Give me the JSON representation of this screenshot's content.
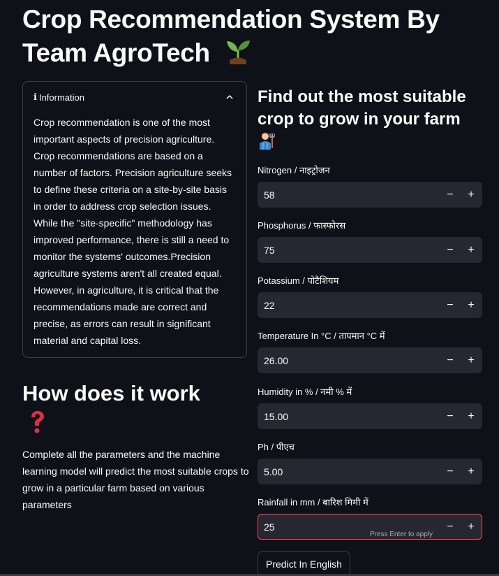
{
  "page": {
    "title": "Crop Recommendation System By Team AgroTech",
    "title_emoji": "seedling"
  },
  "info_panel": {
    "header_icon": "ℹ",
    "header_label": "Information",
    "expanded": true,
    "body": "Crop recommendation is one of the most important aspects of precision agriculture. Crop recommendations are based on a number of factors. Precision agriculture seeks to define these criteria on a site-by-site basis in order to address crop selection issues. While the \"site-specific\" methodology has improved performance, there is still a need to monitor the systems' outcomes.Precision agriculture systems aren't all created equal. However, in agriculture, it is critical that the recommendations made are correct and precise, as errors can result in significant material and capital loss."
  },
  "how": {
    "title": "How does it work",
    "title_emoji": "question-mark",
    "text": "Complete all the parameters and the machine learning model will predict the most suitable crops to grow in a particular farm based on various parameters"
  },
  "form": {
    "title": "Find out the most suitable crop to grow in your farm",
    "title_emoji": "farmer",
    "fields": [
      {
        "label": "Nitrogen / नाइट्रोजन",
        "value": "58"
      },
      {
        "label": "Phosphorus / फास्फोरस",
        "value": "75"
      },
      {
        "label": "Potassium / पोटैशियम",
        "value": "22"
      },
      {
        "label": "Temperature In °C / तापमान °C में",
        "value": "26.00"
      },
      {
        "label": "Humidity in % / नमी % में",
        "value": "15.00"
      },
      {
        "label": "Ph / पीएच",
        "value": "5.00"
      },
      {
        "label": "Rainfall in mm / बारिश मिमी में",
        "value": "25",
        "hint": "Press Enter to apply"
      }
    ],
    "minus_label": "−",
    "plus_label": "+",
    "predict_label": "Predict In English"
  },
  "colors": {
    "background": "#0e1117",
    "input_bg": "#262730",
    "focus_border": "#ff4b4b"
  }
}
